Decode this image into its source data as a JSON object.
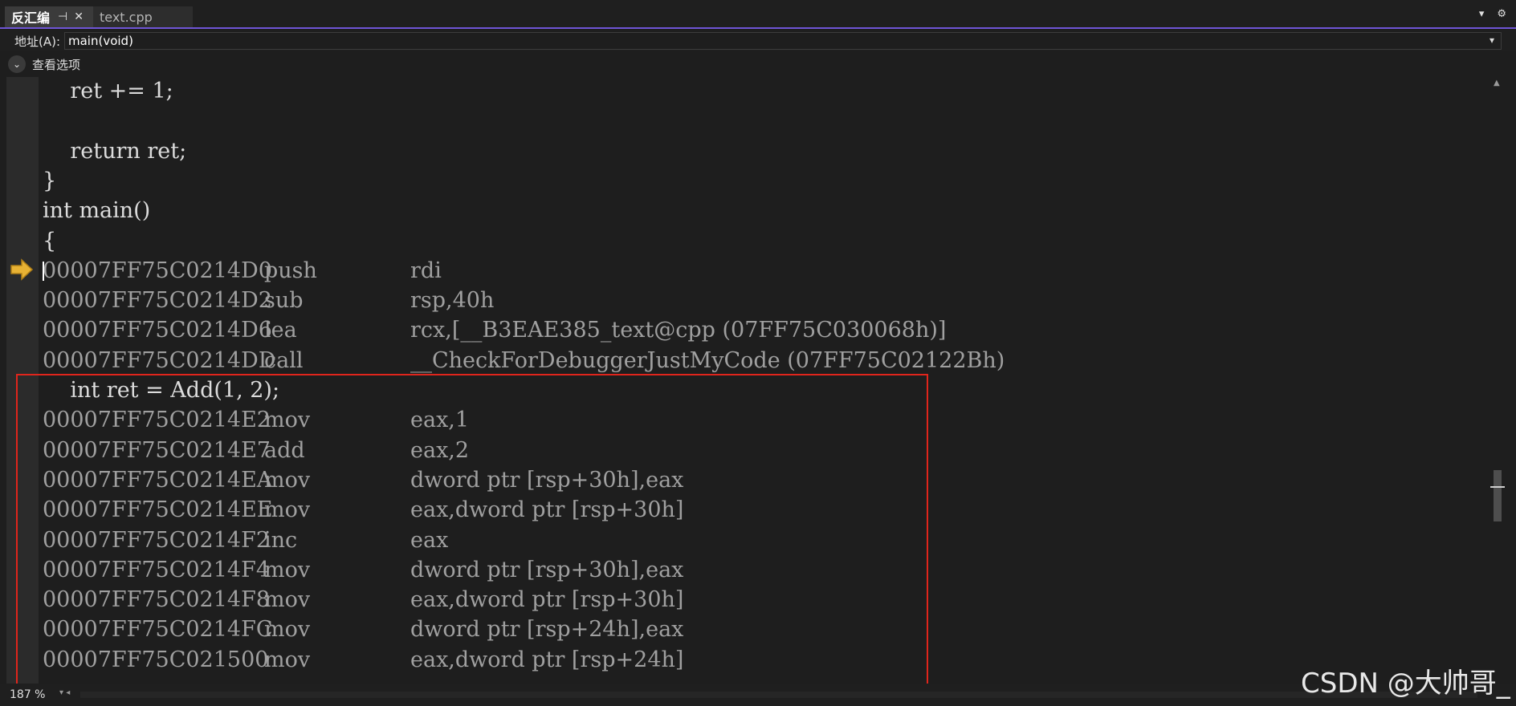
{
  "tabs": [
    {
      "label": "反汇编",
      "active": true
    },
    {
      "label": "text.cpp",
      "active": false
    }
  ],
  "address": {
    "label": "地址(A):",
    "value": "main(void)"
  },
  "view_options_label": "查看选项",
  "code_lines": [
    {
      "kind": "src",
      "text": "    ret += 1;"
    },
    {
      "kind": "src",
      "text": ""
    },
    {
      "kind": "src",
      "text": "    return ret;"
    },
    {
      "kind": "src",
      "text": "}"
    },
    {
      "kind": "src",
      "text": "int main()"
    },
    {
      "kind": "src",
      "text": "{"
    },
    {
      "kind": "asm",
      "addr": "00007FF75C0214D0",
      "op": "push",
      "args": "rdi"
    },
    {
      "kind": "asm",
      "addr": "00007FF75C0214D2",
      "op": "sub",
      "args": "rsp,40h"
    },
    {
      "kind": "asm",
      "addr": "00007FF75C0214D6",
      "op": "lea",
      "args": "rcx,[__B3EAE385_text@cpp (07FF75C030068h)]"
    },
    {
      "kind": "asm",
      "addr": "00007FF75C0214DD",
      "op": "call",
      "args": "__CheckForDebuggerJustMyCode (07FF75C02122Bh)"
    },
    {
      "kind": "src",
      "text": "    int ret = Add(1, 2);"
    },
    {
      "kind": "asm",
      "addr": "00007FF75C0214E2",
      "op": "mov",
      "args": "eax,1"
    },
    {
      "kind": "asm",
      "addr": "00007FF75C0214E7",
      "op": "add",
      "args": "eax,2"
    },
    {
      "kind": "asm",
      "addr": "00007FF75C0214EA",
      "op": "mov",
      "args": "dword ptr [rsp+30h],eax"
    },
    {
      "kind": "asm",
      "addr": "00007FF75C0214EE",
      "op": "mov",
      "args": "eax,dword ptr [rsp+30h]"
    },
    {
      "kind": "asm",
      "addr": "00007FF75C0214F2",
      "op": "inc",
      "args": "eax"
    },
    {
      "kind": "asm",
      "addr": "00007FF75C0214F4",
      "op": "mov",
      "args": "dword ptr [rsp+30h],eax"
    },
    {
      "kind": "asm",
      "addr": "00007FF75C0214F8",
      "op": "mov",
      "args": "eax,dword ptr [rsp+30h]"
    },
    {
      "kind": "asm",
      "addr": "00007FF75C0214FC",
      "op": "mov",
      "args": "dword ptr [rsp+24h],eax"
    },
    {
      "kind": "asm",
      "addr": "00007FF75C021500",
      "op": "mov",
      "args": "eax,dword ptr [rsp+24h]"
    }
  ],
  "zoom": "187 %",
  "watermark": "CSDN @大帅哥_",
  "colors": {
    "accent": "#6f55d6",
    "highlight_box": "#e0251c",
    "ip_arrow": "#e8b234"
  }
}
